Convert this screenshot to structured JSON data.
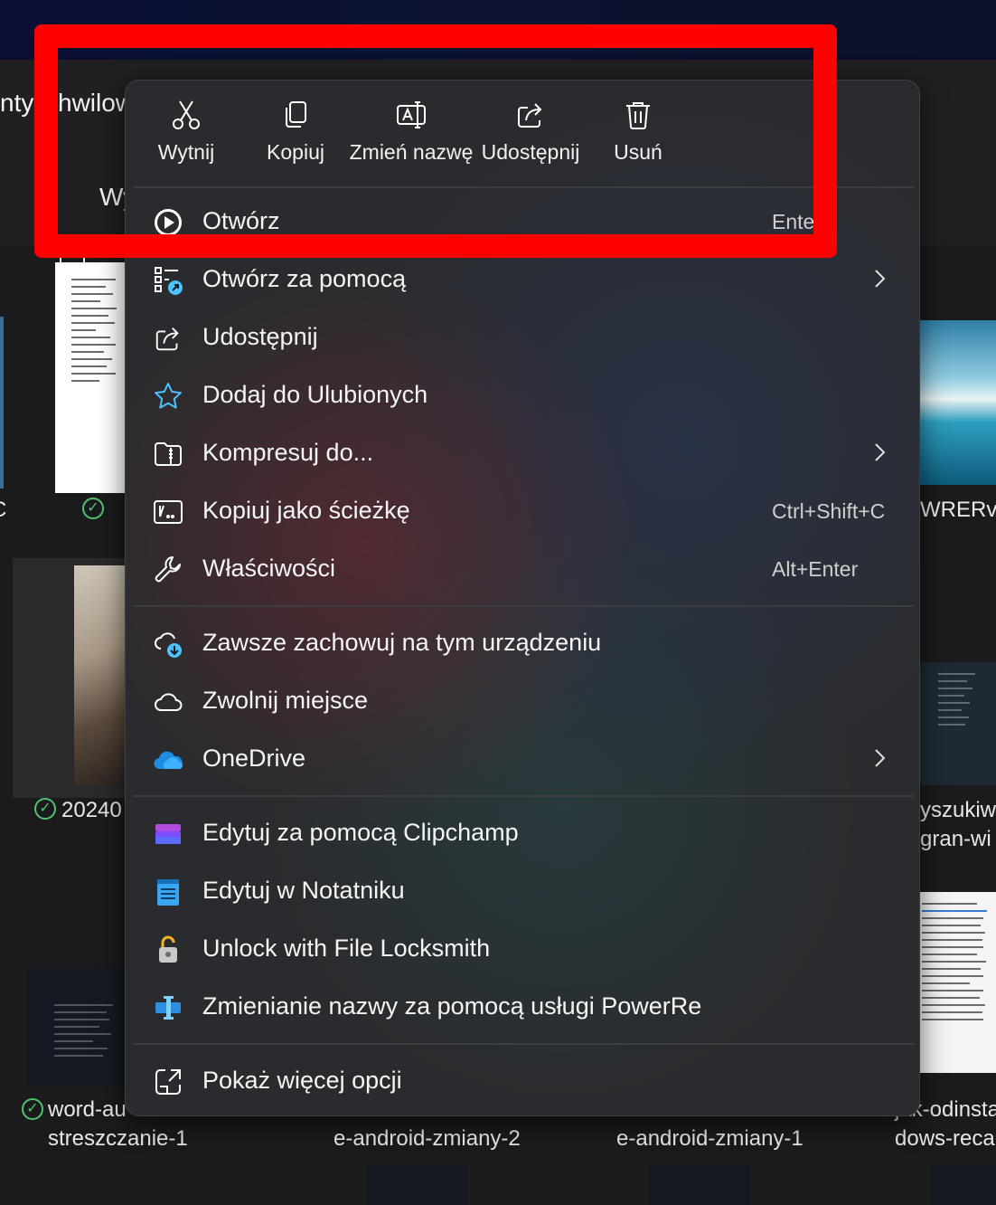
{
  "background": {
    "toolbar_left_fragment": "nty",
    "toolbar_fragment": "hwilow",
    "select_fragment": "Wy",
    "labels": {
      "left_c": "C",
      "wrer": "WRERvP",
      "date": "20240",
      "szukiwa": "yszukiwa",
      "gran": "gran-wi",
      "word": "word-au",
      "stresz": "streszczanie-1",
      "android2": "e-android-zmiany-2",
      "android1": "e-android-zmiany-1",
      "jak": "jak-odinsta",
      "recal": "dows-recal"
    }
  },
  "menu": {
    "quick_actions": [
      {
        "name": "cut",
        "label": "Wytnij",
        "icon": "scissors-icon"
      },
      {
        "name": "copy",
        "label": "Kopiuj",
        "icon": "copy-icon"
      },
      {
        "name": "rename",
        "label": "Zmień nazwę",
        "icon": "rename-icon"
      },
      {
        "name": "share",
        "label": "Udostępnij",
        "icon": "share-icon"
      },
      {
        "name": "delete",
        "label": "Usuń",
        "icon": "trash-icon"
      }
    ],
    "items": [
      {
        "label": "Otwórz",
        "shortcut": "Ente",
        "icon": "play-circle-icon"
      },
      {
        "label": "Otwórz za pomocą",
        "icon": "open-with-icon",
        "submenu": true
      },
      {
        "label": "Udostępnij",
        "icon": "share-icon"
      },
      {
        "label": "Dodaj do Ulubionych",
        "icon": "star-icon"
      },
      {
        "label": "Kompresuj do...",
        "icon": "zip-folder-icon",
        "submenu": true
      },
      {
        "label": "Kopiuj jako ścieżkę",
        "shortcut": "Ctrl+Shift+C",
        "icon": "path-icon"
      },
      {
        "label": "Właściwości",
        "shortcut": "Alt+Enter",
        "icon": "wrench-icon"
      },
      {
        "label": "Zawsze zachowuj na tym urządzeniu",
        "icon": "cloud-download-icon"
      },
      {
        "label": "Zwolnij miejsce",
        "icon": "cloud-icon"
      },
      {
        "label": "OneDrive",
        "icon": "onedrive-icon",
        "submenu": true
      },
      {
        "label": "Edytuj za pomocą Clipchamp",
        "icon": "clipchamp-icon"
      },
      {
        "label": "Edytuj w Notatniku",
        "icon": "notepad-icon"
      },
      {
        "label": "Unlock with File Locksmith",
        "icon": "lock-icon"
      },
      {
        "label": "Zmienianie nazwy za pomocą usługi PowerRe",
        "icon": "powerrename-icon"
      },
      {
        "label": "Pokaż więcej opcji",
        "icon": "more-options-icon"
      }
    ]
  },
  "colors": {
    "highlight": "#ff0000",
    "menu_bg": "#2a2b2e",
    "accent_blue": "#4cc2ff"
  }
}
